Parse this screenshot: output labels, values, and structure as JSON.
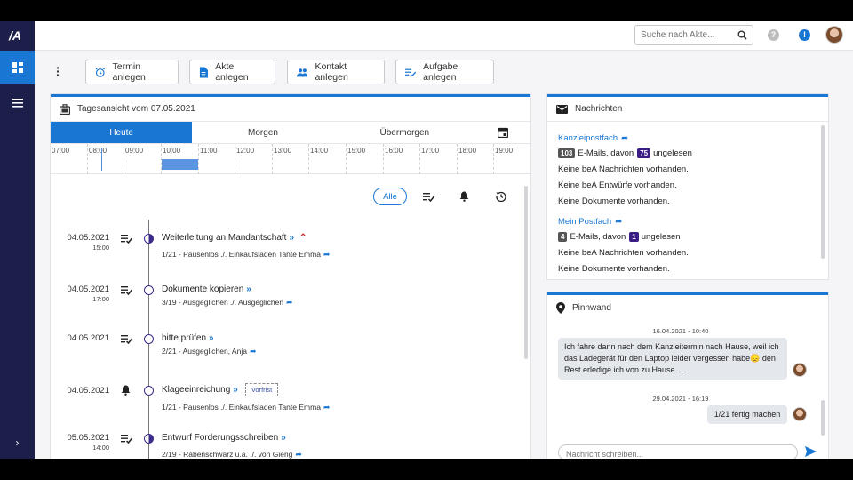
{
  "app": {
    "logo_text": "/A"
  },
  "topbar": {
    "search_placeholder": "Suche nach Akte...",
    "help_icon": "?",
    "notif_icon": "!"
  },
  "toolbar": {
    "buttons": [
      {
        "label": "Termin anlegen",
        "icon": "alarm-clock-icon"
      },
      {
        "label": "Akte anlegen",
        "icon": "document-icon"
      },
      {
        "label": "Kontakt anlegen",
        "icon": "people-icon"
      },
      {
        "label": "Aufgabe anlegen",
        "icon": "task-list-icon"
      }
    ]
  },
  "day_view": {
    "title": "Tagesansicht vom 07.05.2021",
    "tabs": [
      "Heute",
      "Morgen",
      "Übermorgen"
    ],
    "hours": [
      "07:00",
      "08:00",
      "09:00",
      "10:00",
      "11:00",
      "12:00",
      "13:00",
      "14:00",
      "15:00",
      "16:00",
      "17:00",
      "18:00",
      "19:00"
    ],
    "filter_all": "Alle",
    "entries": [
      {
        "date": "04.05.2021",
        "time": "15:00",
        "type": "task",
        "dot": "half",
        "title": "Weiterleitung an Mandantschaft",
        "priority": true,
        "sub": "1/21 - Pausenlos ./. Einkaufsladen Tante Emma"
      },
      {
        "date": "04.05.2021",
        "time": "17:00",
        "type": "task",
        "dot": "empty",
        "title": "Dokumente kopieren",
        "priority": false,
        "sub": "3/19 - Ausgeglichen ./. Ausgeglichen"
      },
      {
        "date": "04.05.2021",
        "time": "",
        "type": "task",
        "dot": "empty",
        "title": "bitte prüfen",
        "priority": false,
        "sub": "2/21 - Ausgeglichen, Anja"
      },
      {
        "date": "04.05.2021",
        "time": "",
        "type": "bell",
        "dot": "empty",
        "title": "Klageeinreichung",
        "priority": false,
        "tag": "Vorfrist",
        "sub": "1/21 - Pausenlos ./. Einkaufsladen Tante Emma"
      },
      {
        "date": "05.05.2021",
        "time": "14:00",
        "type": "task",
        "dot": "half",
        "title": "Entwurf Forderungsschreiben",
        "priority": false,
        "sub": "2/19 - Rabenschwarz u.a. ./. von Gierig"
      }
    ]
  },
  "messages": {
    "title": "Nachrichten",
    "kanzlei": {
      "link": "Kanzleipostfach",
      "emails_count": "103",
      "emails_text": "E-Mails, davon",
      "unread_count": "75",
      "unread_text": "ungelesen",
      "lines": [
        "Keine beA Nachrichten vorhanden.",
        "Keine beA Entwürfe vorhanden.",
        "Keine Dokumente vorhanden."
      ]
    },
    "mein": {
      "link": "Mein Postfach",
      "emails_count": "4",
      "emails_text": "E-Mails, davon",
      "unread_count": "1",
      "unread_text": "ungelesen",
      "lines": [
        "Keine beA Nachrichten vorhanden.",
        "Keine Dokumente vorhanden."
      ]
    }
  },
  "pinboard": {
    "title": "Pinnwand",
    "posts": [
      {
        "date": "16.04.2021 - 10:40",
        "text": "Ich fahre dann nach dem Kanzleitermin nach Hause, weil ich das Ladegerät für den Laptop leider vergessen habe😞  den Rest erledige ich von zu Hause...."
      },
      {
        "date": "29.04.2021 - 16:19",
        "text": "1/21 fertig machen"
      }
    ],
    "input_placeholder": "Nachricht schreiben..."
  },
  "colors": {
    "accent": "#1976d2",
    "rail": "#1c1f4a",
    "badge_purple": "#3a1c84",
    "priority": "#c62828"
  }
}
